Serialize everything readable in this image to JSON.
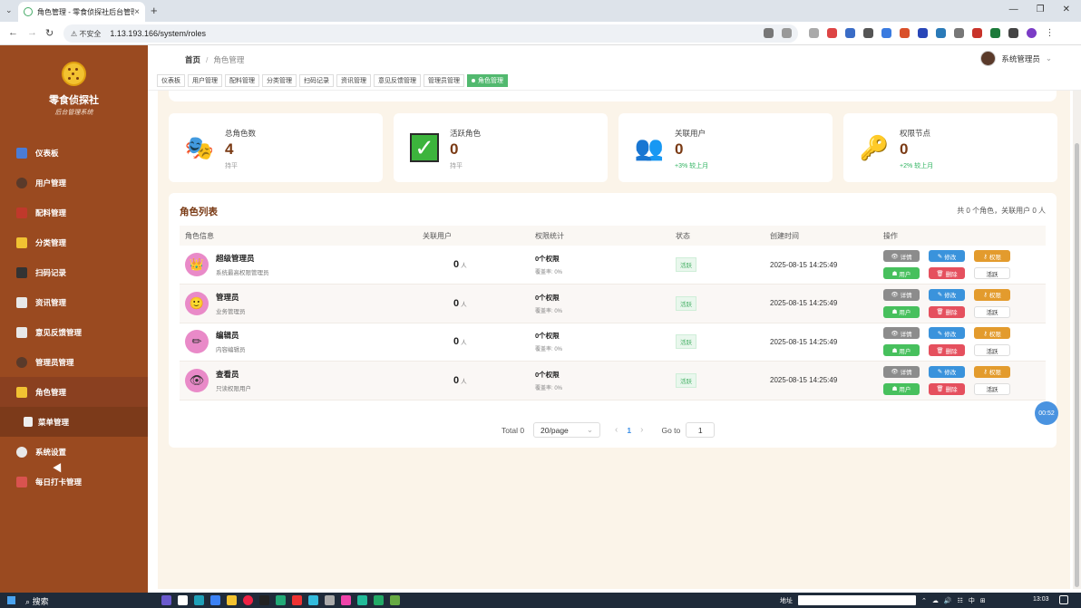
{
  "browser": {
    "tab_title": "角色管理 - 零食侦探社后台管理",
    "security_label": "不安全",
    "url": "1.13.193.166/system/roles"
  },
  "sidebar": {
    "brand": "零食侦探社",
    "subtitle": "后台管理系统",
    "items": [
      {
        "label": "仪表板",
        "icon": "chart-icon",
        "color": "#4a7cd6"
      },
      {
        "label": "用户管理",
        "icon": "user-icon",
        "color": "#5a3a2a"
      },
      {
        "label": "配料管理",
        "icon": "ingredient-icon",
        "color": "#c0392b"
      },
      {
        "label": "分类管理",
        "icon": "folder-icon",
        "color": "#f1c232"
      },
      {
        "label": "扫码记录",
        "icon": "scan-icon",
        "color": "#333333"
      },
      {
        "label": "资讯管理",
        "icon": "news-icon",
        "color": "#e8e8e8"
      },
      {
        "label": "意见反馈管理",
        "icon": "feedback-icon",
        "color": "#e8e8e8"
      },
      {
        "label": "管理员管理",
        "icon": "admin-icon",
        "color": "#5a3a2a"
      },
      {
        "label": "角色管理",
        "icon": "key-icon",
        "color": "#f1c232"
      },
      {
        "label": "菜单管理",
        "icon": "menu-doc-icon",
        "color": "#e8e8e8"
      },
      {
        "label": "系统设置",
        "icon": "gear-icon",
        "color": "#e8e8e8"
      },
      {
        "label": "每日打卡管理",
        "icon": "calendar-icon",
        "color": "#d9534f"
      }
    ]
  },
  "header": {
    "breadcrumb_home": "首页",
    "breadcrumb_current": "角色管理",
    "user_name": "系统管理员",
    "tags": [
      "仪表板",
      "用户管理",
      "配料管理",
      "分类管理",
      "扫码记录",
      "资讯管理",
      "意见反馈管理",
      "管理员管理",
      "角色管理"
    ]
  },
  "stats": [
    {
      "label": "总角色数",
      "value": "4",
      "sub": "持平",
      "icon": "masks-icon",
      "up": false
    },
    {
      "label": "活跃角色",
      "value": "0",
      "sub": "持平",
      "icon": "check-icon",
      "up": false
    },
    {
      "label": "关联用户",
      "value": "0",
      "sub": "+3% 较上月",
      "icon": "users-icon",
      "up": true
    },
    {
      "label": "权限节点",
      "value": "0",
      "sub": "+2% 较上月",
      "icon": "key-icon",
      "up": true
    }
  ],
  "panel": {
    "title": "角色列表",
    "summary": "共 0 个角色，关联用户 0 人",
    "columns": [
      "角色信息",
      "关联用户",
      "权限统计",
      "状态",
      "创建时间",
      "操作"
    ],
    "rows": [
      {
        "name": "超级管理员",
        "desc": "系统最高权限管理员",
        "icon": "crown-icon",
        "users": "0",
        "unit": "人",
        "perm": "0个权限",
        "coverage": "覆盖率: 0%",
        "status": "活跃",
        "time": "2025-08-15 14:25:49"
      },
      {
        "name": "管理员",
        "desc": "业务管理员",
        "icon": "person-icon",
        "users": "0",
        "unit": "人",
        "perm": "0个权限",
        "coverage": "覆盖率: 0%",
        "status": "活跃",
        "time": "2025-08-15 14:25:49"
      },
      {
        "name": "编辑员",
        "desc": "内容编辑员",
        "icon": "pencil-icon",
        "users": "0",
        "unit": "人",
        "perm": "0个权限",
        "coverage": "覆盖率: 0%",
        "status": "活跃",
        "time": "2025-08-15 14:25:49"
      },
      {
        "name": "查看员",
        "desc": "只读权限用户",
        "icon": "eye-icon",
        "users": "0",
        "unit": "人",
        "perm": "0个权限",
        "coverage": "覆盖率: 0%",
        "status": "活跃",
        "time": "2025-08-15 14:25:49"
      }
    ],
    "actions": {
      "detail": "详情",
      "edit": "修改",
      "perm": "权限",
      "users": "用户",
      "delete": "删除",
      "toggle": "活跃"
    }
  },
  "pagination": {
    "total": "Total 0",
    "page_size": "20/page",
    "current": "1",
    "goto_label": "Go to",
    "goto_value": "1"
  },
  "timer": "00:52",
  "taskbar": {
    "search": "搜索",
    "address_label": "地址",
    "lang": "中",
    "time": "13:03"
  }
}
